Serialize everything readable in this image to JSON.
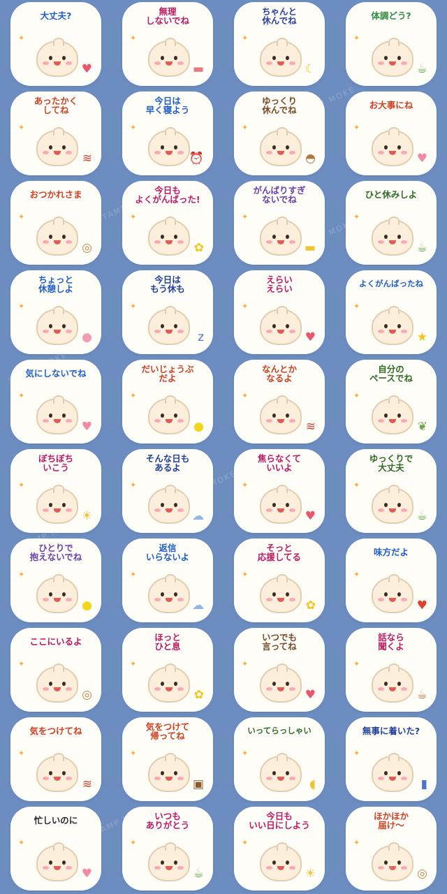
{
  "watermark": "STAMP MOKE",
  "stickers": [
    {
      "text": "大丈夫?",
      "color": "#1f5fc8",
      "prop": "♥",
      "propColor": "#e8556d"
    },
    {
      "text": "無理\nしないでね",
      "color": "#c2185b",
      "prop": "▬",
      "propColor": "#e77b7b"
    },
    {
      "text": "ちゃんと\n休んでね",
      "color": "#2e3fa8",
      "prop": "☾",
      "propColor": "#f1c232"
    },
    {
      "text": "体調どう?",
      "color": "#2e8b3a",
      "prop": "☕",
      "propColor": "#6aa84f"
    },
    {
      "text": "あったかく\nしてね",
      "color": "#d2401f",
      "prop": "≋",
      "propColor": "#e0402d"
    },
    {
      "text": "今日は\n早く寝よう",
      "color": "#1f5fc8",
      "prop": "⏰",
      "propColor": "#3d6fd1"
    },
    {
      "text": "ゆっくり\n休んでね",
      "color": "#7a4a1e",
      "prop": "◓",
      "propColor": "#b07a40"
    },
    {
      "text": "お大事にね",
      "color": "#d2401f",
      "prop": "♥",
      "propColor": "#f08aa4"
    },
    {
      "text": "おつかれさま",
      "color": "#d2401f",
      "prop": "◎",
      "propColor": "#c58a4a"
    },
    {
      "text": "今日も\nよくがんばった!",
      "color": "#c2185b",
      "prop": "✿",
      "propColor": "#f5c518"
    },
    {
      "text": "がんばりすぎ\nないでね",
      "color": "#6a3fb0",
      "prop": "▬",
      "propColor": "#f1c232"
    },
    {
      "text": "ひと休みしよ",
      "color": "#2e6b1f",
      "prop": "☕",
      "propColor": "#6aa84f"
    },
    {
      "text": "ちょっと\n休憩しよ",
      "color": "#1f5fc8",
      "prop": "●",
      "propColor": "#f39bb5"
    },
    {
      "text": "今日は\nもう休も",
      "color": "#1f3f9a",
      "prop": "z",
      "propColor": "#4f74c9"
    },
    {
      "text": "えらい\nえらい",
      "color": "#c2185b",
      "prop": "♥",
      "propColor": "#e8556d"
    },
    {
      "text": "よくがんばったね",
      "color": "#1f5fc8",
      "prop": "★",
      "propColor": "#f5c518"
    },
    {
      "text": "気にしないでね",
      "color": "#1f5fc8",
      "prop": "♥",
      "propColor": "#f08aa4"
    },
    {
      "text": "だいじょうぶ\nだよ",
      "color": "#d2401f",
      "prop": "●",
      "propColor": "#f5d518"
    },
    {
      "text": "なんとか\nなるよ",
      "color": "#d2401f",
      "prop": "≋",
      "propColor": "#e0402d"
    },
    {
      "text": "自分の\nペースでね",
      "color": "#2e6b1f",
      "prop": "❦",
      "propColor": "#6aa84f"
    },
    {
      "text": "ぼちぼち\nいこう",
      "color": "#c2185b",
      "prop": "☀",
      "propColor": "#f1c232"
    },
    {
      "text": "そんな日も\nあるよ",
      "color": "#1f3f9a",
      "prop": "☁",
      "propColor": "#8fb4e8"
    },
    {
      "text": "焦らなくて\nいいよ",
      "color": "#c2185b",
      "prop": "♥",
      "propColor": "#e8556d"
    },
    {
      "text": "ゆっくりで\n大丈夫",
      "color": "#2e6b1f",
      "prop": "☕",
      "propColor": "#6aa84f"
    },
    {
      "text": "ひとりで\n抱えないでね",
      "color": "#6a3fb0",
      "prop": "●",
      "propColor": "#f5d518"
    },
    {
      "text": "返信\nいらないよ",
      "color": "#1f5fc8",
      "prop": "☁",
      "propColor": "#8fb4e8"
    },
    {
      "text": "そっと\n応援してる",
      "color": "#c2185b",
      "prop": "✿",
      "propColor": "#f5c518"
    },
    {
      "text": "味方だよ",
      "color": "#1f5fc8",
      "prop": "♥",
      "propColor": "#e0402d"
    },
    {
      "text": "ここにいるよ",
      "color": "#c2185b",
      "prop": "◎",
      "propColor": "#c58a4a"
    },
    {
      "text": "ほっと\nひと息",
      "color": "#c2185b",
      "prop": "✿",
      "propColor": "#f5c518"
    },
    {
      "text": "いつでも\n言ってね",
      "color": "#7a4a1e",
      "prop": "♥",
      "propColor": "#e8556d"
    },
    {
      "text": "話なら\n聞くよ",
      "color": "#c2185b",
      "prop": "☕",
      "propColor": "#b07a40"
    },
    {
      "text": "気をつけてね",
      "color": "#d2401f",
      "prop": "≋",
      "propColor": "#e0402d"
    },
    {
      "text": "気をつけて\n帰ってね",
      "color": "#d2401f",
      "prop": "▣",
      "propColor": "#8a5a2a"
    },
    {
      "text": "いってらっしゃい",
      "color": "#2e6b1f",
      "prop": "◖",
      "propColor": "#f1c232"
    },
    {
      "text": "無事に着いた?",
      "color": "#1f3f9a",
      "prop": "▮",
      "propColor": "#4f74c9"
    },
    {
      "text": "忙しいのに",
      "color": "#2b2b2b",
      "prop": "♥",
      "propColor": "#f08aa4"
    },
    {
      "text": "いつも\nありがとう",
      "color": "#c2185b",
      "prop": "☕",
      "propColor": "#6aa84f"
    },
    {
      "text": "今日も\nいい日にしよう",
      "color": "#c2185b",
      "prop": "☀",
      "propColor": "#f1c232"
    },
    {
      "text": "ほかほか\n届け〜",
      "color": "#d2401f",
      "prop": "◎",
      "propColor": "#c58a4a"
    }
  ]
}
